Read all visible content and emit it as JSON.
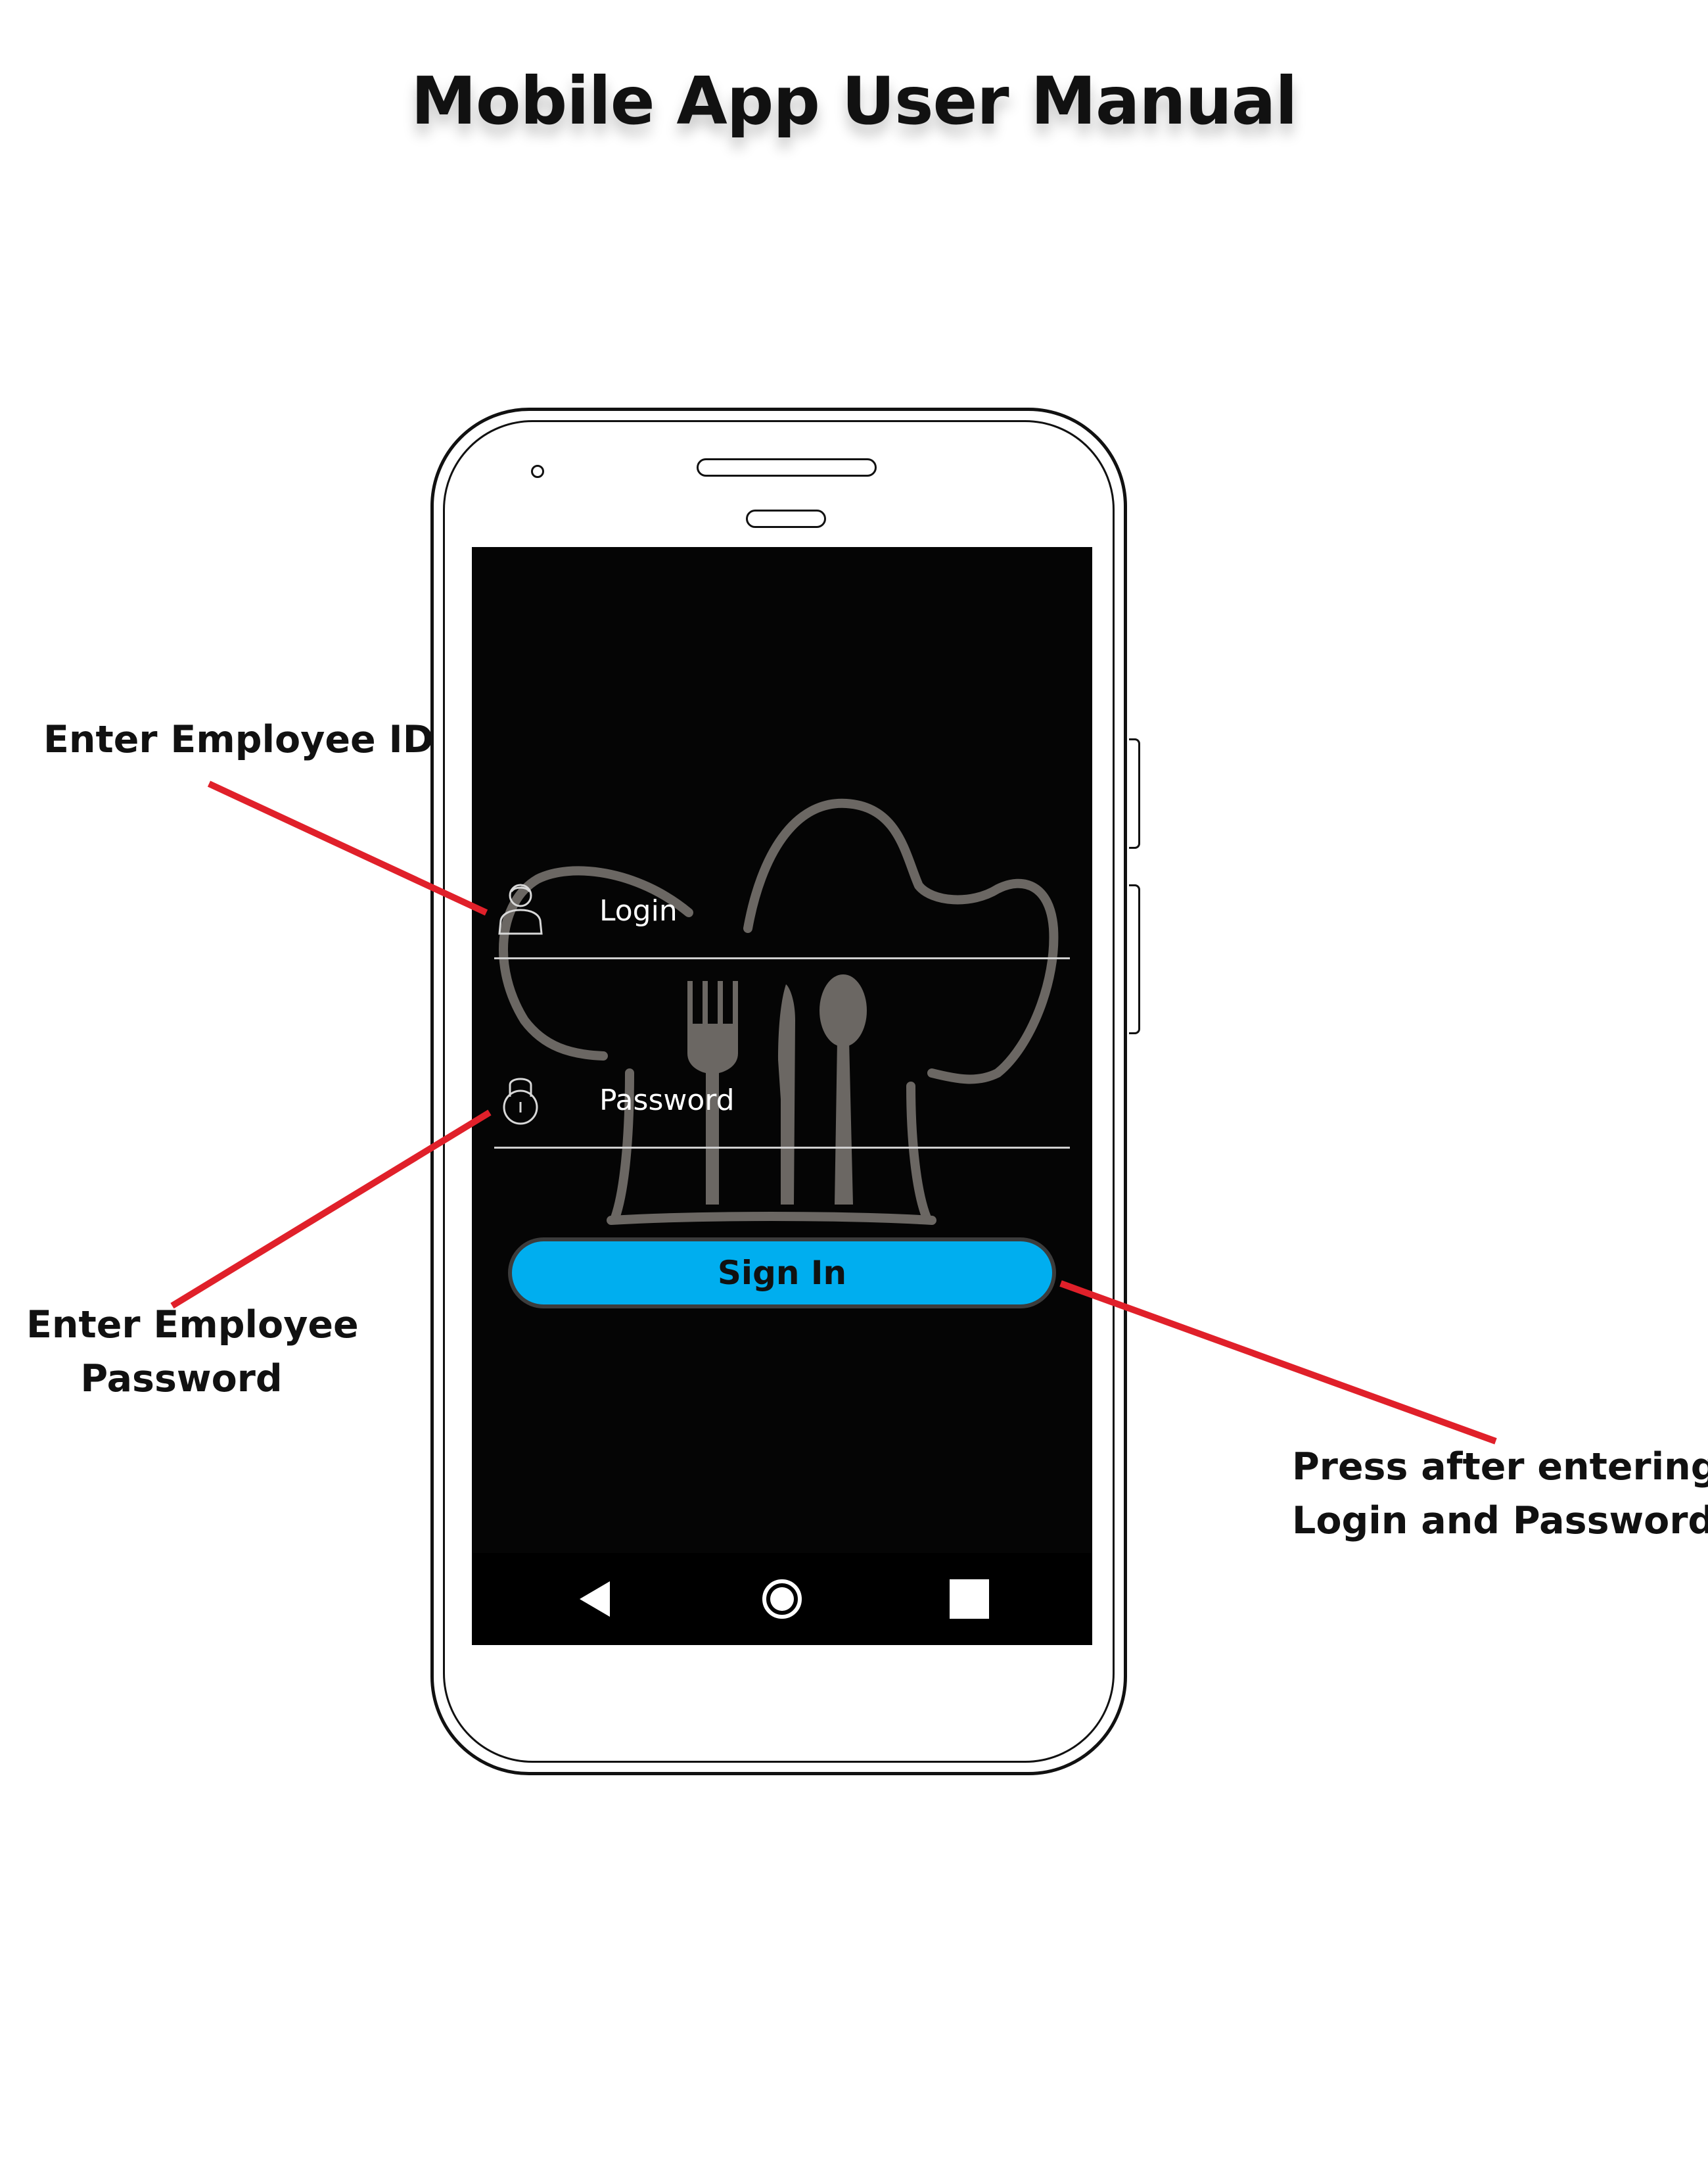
{
  "page": {
    "title": "Mobile App User Manual"
  },
  "annotations": {
    "login_hint": "Enter Employee ID",
    "password_hint_line1": "Enter Employee",
    "password_hint_line2": "Password",
    "signin_hint_line1": "Press after entering",
    "signin_hint_line2": "Login and Password"
  },
  "login_screen": {
    "login_placeholder": "Login",
    "password_placeholder": "Password",
    "signin_label": "Sign In",
    "logo_icon": "chef-hat-with-cutlery-logo"
  },
  "navigation_bar": {
    "back_icon": "back-triangle-icon",
    "home_icon": "home-circle-icon",
    "recents_icon": "recents-square-icon"
  },
  "colors": {
    "screen_background": "#050505",
    "signin_button": "#00aeef",
    "callout_line": "#e0202a",
    "logo_stroke": "#6b6763"
  }
}
